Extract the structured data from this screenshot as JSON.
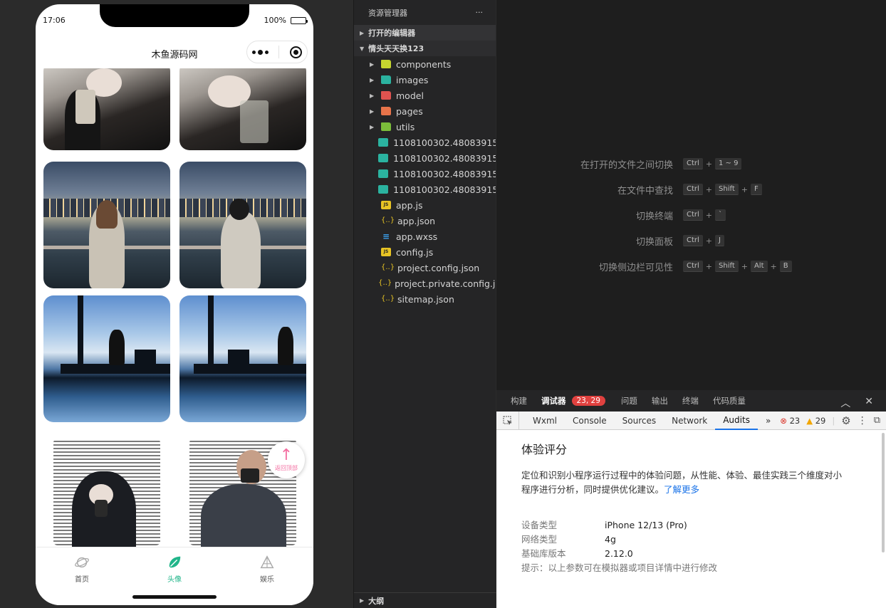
{
  "simulator": {
    "status_time": "17:06",
    "battery": "100%",
    "nav_title": "木鱼源码网",
    "back_to_top": "返回顶部",
    "tabs": [
      {
        "label": "首页",
        "icon": "planet-icon",
        "active": false
      },
      {
        "label": "头像",
        "icon": "leaf-icon",
        "active": true
      },
      {
        "label": "娱乐",
        "icon": "triangle-icon",
        "active": false
      }
    ],
    "accent_color": "#21b58a"
  },
  "explorer": {
    "title": "资源管理器",
    "more": "···",
    "open_editors": "打开的编辑器",
    "project": "情头天天换123",
    "outline": "大纲",
    "items": [
      {
        "name": "components",
        "type": "folder",
        "color": "#c6d62f"
      },
      {
        "name": "images",
        "type": "folder",
        "color": "#2bb3a0"
      },
      {
        "name": "model",
        "type": "folder",
        "color": "#e0534f"
      },
      {
        "name": "pages",
        "type": "folder",
        "color": "#e8744a"
      },
      {
        "name": "utils",
        "type": "folder",
        "color": "#7bbd3a"
      },
      {
        "name": "1108100302.48083915...",
        "type": "image"
      },
      {
        "name": "1108100302.48083915...",
        "type": "image"
      },
      {
        "name": "1108100302.48083915...",
        "type": "image"
      },
      {
        "name": "1108100302.48083915...",
        "type": "image"
      },
      {
        "name": "app.js",
        "type": "js"
      },
      {
        "name": "app.json",
        "type": "json"
      },
      {
        "name": "app.wxss",
        "type": "css"
      },
      {
        "name": "config.js",
        "type": "js"
      },
      {
        "name": "project.config.json",
        "type": "json"
      },
      {
        "name": "project.private.config.js...",
        "type": "json"
      },
      {
        "name": "sitemap.json",
        "type": "json"
      }
    ]
  },
  "shortcuts": [
    {
      "label": "在打开的文件之间切换",
      "keys": [
        "Ctrl",
        "1 ~ 9"
      ]
    },
    {
      "label": "在文件中查找",
      "keys": [
        "Ctrl",
        "Shift",
        "F"
      ]
    },
    {
      "label": "切换终端",
      "keys": [
        "Ctrl",
        "`"
      ]
    },
    {
      "label": "切换面板",
      "keys": [
        "Ctrl",
        "J"
      ]
    },
    {
      "label": "切换侧边栏可见性",
      "keys": [
        "Ctrl",
        "Shift",
        "Alt",
        "B"
      ]
    }
  ],
  "panel": {
    "tabs": [
      "构建",
      "调试器",
      "问题",
      "输出",
      "终端",
      "代码质量"
    ],
    "badge": "23, 29",
    "devtools_tabs": [
      "Wxml",
      "Console",
      "Sources",
      "Network",
      "Audits"
    ],
    "active_devtools_tab": "Audits",
    "more": "»",
    "errors": "23",
    "warnings": "29"
  },
  "audit": {
    "title": "体验评分",
    "description": "定位和识别小程序运行过程中的体验问题，从性能、体验、最佳实践三个维度对小程序进行分析，同时提供优化建议。",
    "learn_more": "了解更多",
    "device_label": "设备类型",
    "device_value": "iPhone 12/13 (Pro)",
    "network_label": "网络类型",
    "network_value": "4g",
    "lib_label": "基础库版本",
    "lib_value": "2.12.0",
    "tip": "提示：以上参数可在模拟器或项目详情中进行修改"
  }
}
